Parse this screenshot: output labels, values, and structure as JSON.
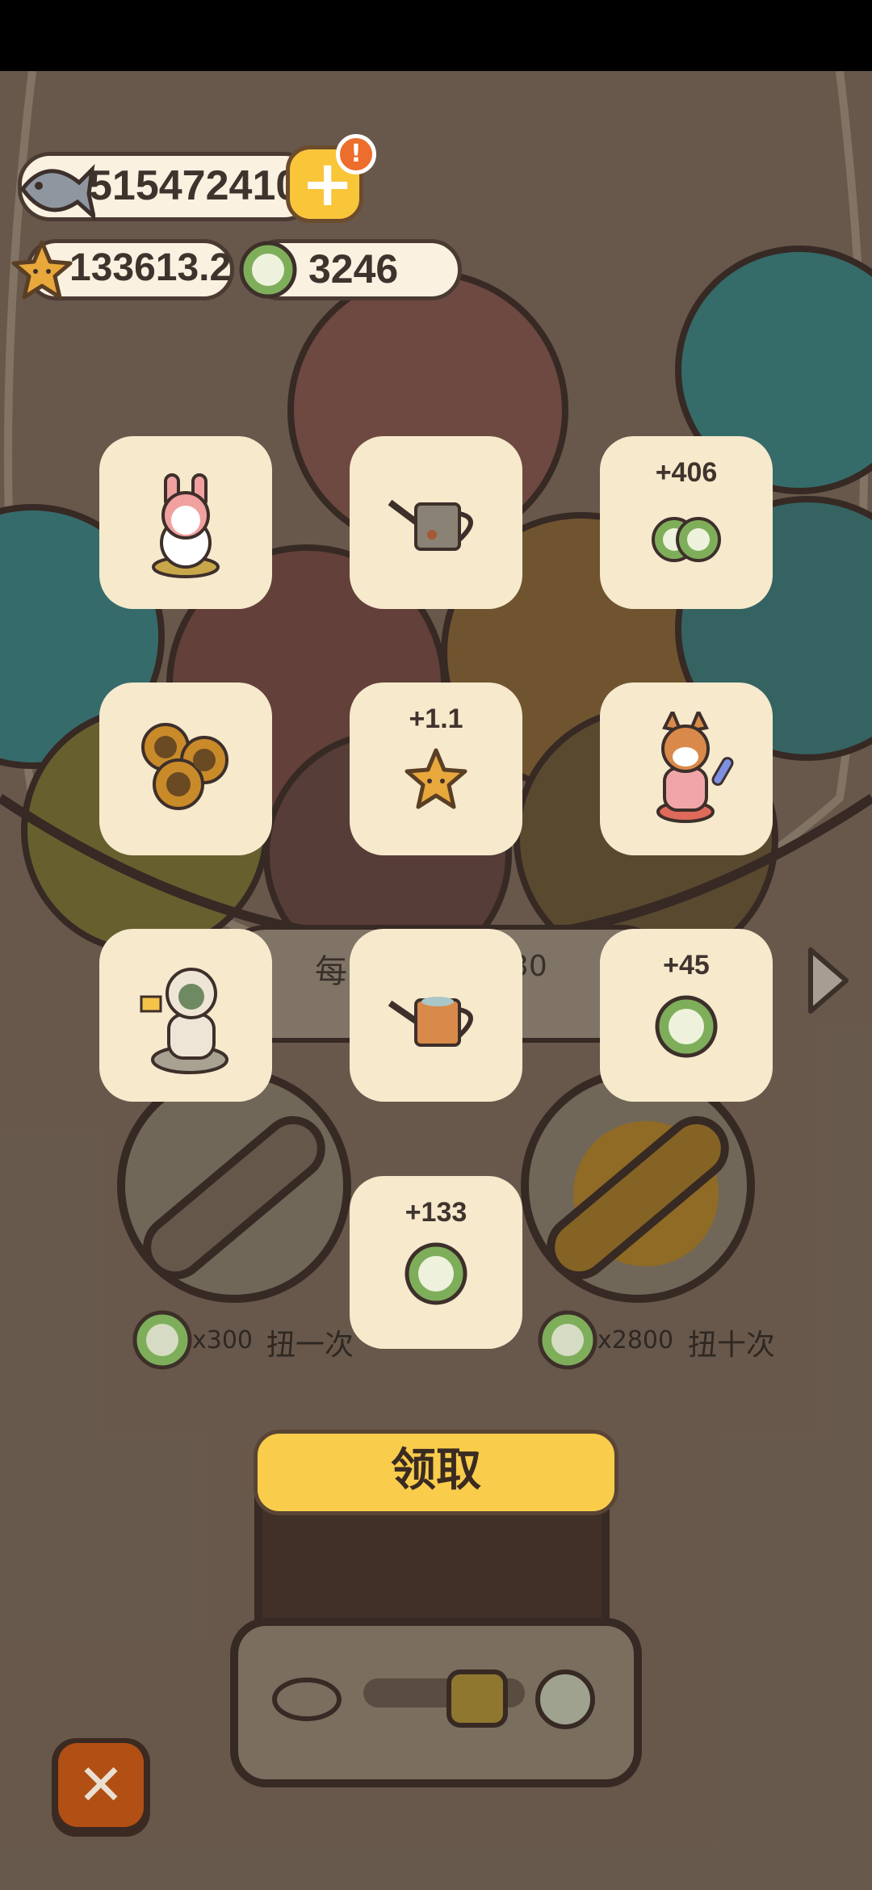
{
  "currencies": {
    "fish": "515472410",
    "stars": "133613.2",
    "coins": "3246",
    "alert_mark": "!",
    "add_label": "+"
  },
  "rewards": [
    {
      "icon": "bunny-pet-icon",
      "amount": ""
    },
    {
      "icon": "rusty-watering-can-icon",
      "amount": ""
    },
    {
      "icon": "green-coins-icon",
      "amount": "+406"
    },
    {
      "icon": "sunflower-bunch-icon",
      "amount": ""
    },
    {
      "icon": "star-icon",
      "amount": "+1.1"
    },
    {
      "icon": "corgi-pet-icon",
      "amount": ""
    },
    {
      "icon": "duck-statue-icon",
      "amount": ""
    },
    {
      "icon": "orange-watering-can-icon",
      "amount": ""
    },
    {
      "icon": "green-coin-icon",
      "amount": "+45"
    },
    {
      "icon": "green-coin-icon",
      "amount": "+133"
    }
  ],
  "banner": {
    "left_char": "每",
    "right_digits": "30"
  },
  "spin_once": {
    "cost": "x300",
    "label": "扭一次"
  },
  "spin_ten": {
    "cost": "x2800",
    "label": "扭十次"
  },
  "claim_label": "领取",
  "close_label": "✕",
  "colors": {
    "card": "#f6e9cc",
    "claim_button": "#f9cd4b",
    "close_button": "#b24f14",
    "coin_green": "#7fae5b",
    "star_gold": "#e9a83c"
  }
}
